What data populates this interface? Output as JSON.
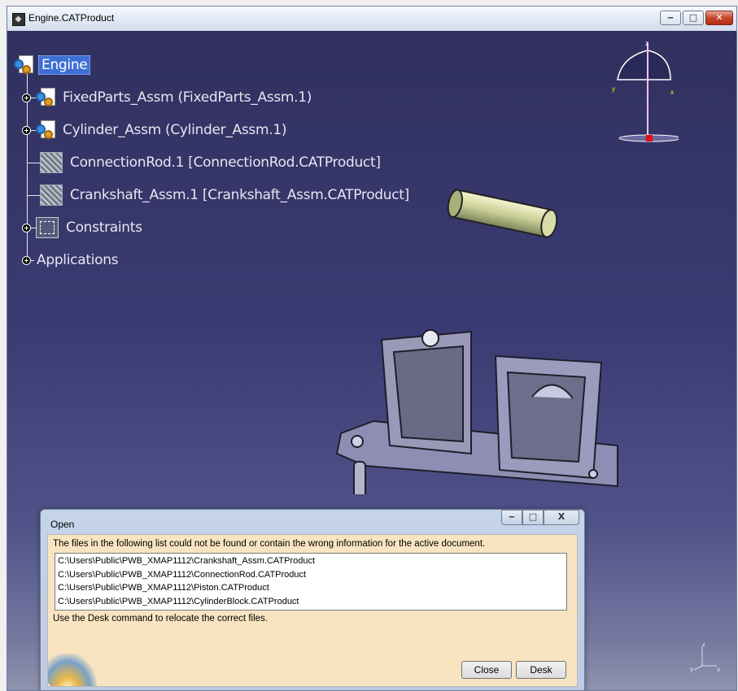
{
  "window": {
    "title": "Engine.CATProduct",
    "buttons": {
      "minimize": "‒",
      "maximize": "□",
      "close": "✕"
    }
  },
  "tree": {
    "root": "Engine",
    "items": [
      {
        "label": "FixedParts_Assm (FixedParts_Assm.1)",
        "icon": "product-icon",
        "expandable": true
      },
      {
        "label": "Cylinder_Assm (Cylinder_Assm.1)",
        "icon": "product-icon",
        "expandable": true
      },
      {
        "label": "ConnectionRod.1 [ConnectionRod.CATProduct]",
        "icon": "missing-part-icon",
        "expandable": false
      },
      {
        "label": "Crankshaft_Assm.1 [Crankshaft_Assm.CATProduct]",
        "icon": "missing-part-icon",
        "expandable": false
      },
      {
        "label": "Constraints",
        "icon": "constraints-icon",
        "expandable": true
      },
      {
        "label": "Applications",
        "icon": "",
        "expandable": true
      }
    ]
  },
  "compass": {
    "x": "x",
    "y": "y",
    "z": "z"
  },
  "axis": {
    "x": "x",
    "y": "y",
    "z": "z"
  },
  "dialog": {
    "title": "Open",
    "buttons": {
      "minimize": "‒",
      "maximize": "□",
      "close": "X"
    },
    "message": "The files in the following list could not be found or contain the wrong information for the active document.",
    "files": [
      "C:\\Users\\Public\\PWB_XMAP1112\\Crankshaft_Assm.CATProduct",
      "C:\\Users\\Public\\PWB_XMAP1112\\ConnectionRod.CATProduct",
      "C:\\Users\\Public\\PWB_XMAP1112\\Piston.CATProduct",
      "C:\\Users\\Public\\PWB_XMAP1112\\CylinderBlock.CATProduct"
    ],
    "hint": "Use the Desk command to relocate the correct files.",
    "close_label": "Close",
    "desk_label": "Desk"
  },
  "colors": {
    "viewport_top": "#31305f",
    "viewport_bottom": "#8f93ad",
    "selection": "#3e6fd4",
    "dialog_body": "#f9e4c1"
  }
}
